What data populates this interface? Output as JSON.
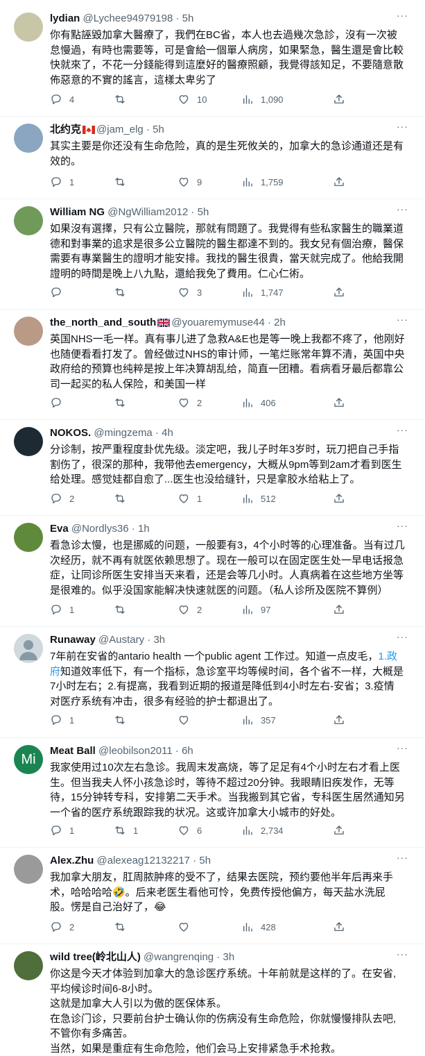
{
  "tweets": [
    {
      "name": "lydian",
      "handle": "@Lychee94979198",
      "time": "5h",
      "avatar_color": "#c9c6a8",
      "avatar_text": "",
      "flag": "",
      "lines": [
        "你有點誣毀加拿大醫療了，我們在BC省，本人也去過幾次急診，沒有一次被",
        "怠慢過，有時也需要等，可是會給一個單人病房，如果緊急，醫生還是會比較",
        "快就來了，不花一分錢能得到這麼好的醫療照顧，我覺得該知足，不要隨意散",
        "佈惡意的不實的謠言，這樣太卑劣了"
      ],
      "replies": "4",
      "retweets": "",
      "likes": "10",
      "views": "1,090"
    },
    {
      "name": "北约克",
      "handle": "@jam_elg",
      "time": "5h",
      "avatar_color": "#8aa6c0",
      "avatar_text": "",
      "flag": "ca",
      "lines": [
        "其实主要是你还没有生命危险，真的是生死攸关的，加拿大的急诊通道还是有",
        "效的。"
      ],
      "replies": "1",
      "retweets": "",
      "likes": "9",
      "views": "1,759"
    },
    {
      "name": "William NG",
      "handle": "@NgWilliam2012",
      "time": "5h",
      "avatar_color": "#6f9a5a",
      "avatar_text": "",
      "flag": "",
      "lines": [
        "如果沒有選擇，只有公立醫院，那就有問題了。我覺得有些私家醫生的職業道",
        "德和對事業的追求是很多公立醫院的醫生都達不到的。我女兒有個治療，醫保",
        "需要有專業醫生的證明才能安排。我找的醫生很貴，當天就完成了。他給我開",
        "證明的時間是晚上八九點，還給我免了費用。仁心仁術。"
      ],
      "replies": "",
      "retweets": "",
      "likes": "3",
      "views": "1,747"
    },
    {
      "name": "the_north_and_south",
      "handle": "@youaremymuse44",
      "time": "2h",
      "avatar_color": "#b99a86",
      "avatar_text": "",
      "flag": "gb",
      "lines": [
        "英国NHS一毛一样。真有事儿进了急救A&E也是等一晚上我都不疼了，他刚好",
        "也随便看看打发了。曾经做过NHS的审计师，一笔烂账常年算不清，英国中央",
        "政府给的预算也纯粹是按上年决算胡乱给，简直一团糟。看病看牙最后都靠公",
        "司一起买的私人保险，和美国一样"
      ],
      "replies": "",
      "retweets": "",
      "likes": "2",
      "views": "406"
    },
    {
      "name": "NOKOS.",
      "handle": "@mingzema",
      "time": "4h",
      "avatar_color": "#1d2a33",
      "avatar_text": "",
      "flag": "",
      "lines": [
        "分诊制，按严重程度卦优先级。淡定吧，我儿子时年3岁时，玩刀把自己手指",
        "割伤了，很深的那种，我带他去emergency，大概从9pm等到2am才看到医生",
        "给处理。感觉娃都自愈了...医生也没给缝针，只是拿胶水给粘上了。"
      ],
      "replies": "2",
      "retweets": "",
      "likes": "1",
      "views": "512"
    },
    {
      "name": "Eva",
      "handle": "@Nordlys36",
      "time": "1h",
      "avatar_color": "#5f8a3c",
      "avatar_text": "",
      "flag": "",
      "lines": [
        "看急诊太慢，也是挪威的问题，一般要有3，4个小时等的心理准备。当有过几",
        "次经历，就不再有就医依赖思想了。现在一般可以在固定医生处一早电话报急",
        "症，让同诊所医生安排当天来看，还是会等几小时。人真病着在这些地方坐等",
        "是很难的。似乎没国家能解决快速就医的问题。（私人诊所及医院不算例）"
      ],
      "replies": "1",
      "retweets": "",
      "likes": "2",
      "views": "97"
    },
    {
      "name": "Runaway",
      "handle": "@Austary",
      "time": "3h",
      "avatar_color": "#cfd9de",
      "avatar_text": "",
      "flag": "",
      "line1_pre": "7年前在安省的antario health 一个public agent 工作过。知道一点皮毛，",
      "line1_link": "1.政",
      "line2_link": "府",
      "line2_post": "知道效率低下，有一个指标，急诊室平均等候时间，各个省不一样，大概是",
      "lines": [
        "7小时左右；2.有提高，我看到近期的报道是降低到4小时左右-安省；3.疫情",
        "对医疗系统有冲击，很多有经验的护士都退出了。"
      ],
      "replies": "1",
      "retweets": "",
      "likes": "",
      "views": "357"
    },
    {
      "name": "Meat Ball",
      "handle": "@leobilson2011",
      "time": "6h",
      "avatar_color": "#1a8551",
      "avatar_text": "Mi",
      "flag": "",
      "lines": [
        "我家使用过10次左右急诊。我周末发高烧，等了足足有4个小时左右才看上医",
        "生。但当我夫人怀小孩急诊时，等待不超过20分钟。我眼睛旧疾发作，无等",
        "待，15分钟转专科，安排第二天手术。当我搬到其它省，专科医生居然通知另",
        "一个省的医疗系统跟踪我的状况。这或许加拿大小城市的好处。"
      ],
      "replies": "1",
      "retweets": "1",
      "likes": "6",
      "views": "2,734"
    },
    {
      "name": "Alex.Zhu",
      "handle": "@alexeag12132217",
      "time": "5h",
      "avatar_color": "#9a9a9a",
      "avatar_text": "",
      "flag": "",
      "lines": [
        "我加拿大朋友，肛周脓肿疼的受不了，结果去医院，预约要他半年后再来手",
        "术，哈哈哈哈🤣。后来老医生看他可怜，免费传授他偏方，每天盐水洗屁",
        "股。愣是自己治好了，😂"
      ],
      "replies": "2",
      "retweets": "",
      "likes": "",
      "views": "428"
    },
    {
      "name": "wild tree(岭北山人)",
      "handle": "@wangrenqing",
      "time": "3h",
      "avatar_color": "#4f6e3a",
      "avatar_text": "",
      "flag": "",
      "lines": [
        "你这是今天才体验到加拿大的急诊医疗系统。十年前就是这样的了。在安省,",
        "平均候诊时间6-8小时。",
        "这就是加拿大人引以为傲的医保体系。",
        "在急诊门诊，只要前台护士确认你的伤病没有生命危险，你就慢慢排队去吧,",
        "不管你有多痛苦。",
        "当然，如果是重症有生命危险，他们会马上安排紧急手术抢救。"
      ],
      "replies": "",
      "retweets": "",
      "likes": "",
      "views": ""
    }
  ]
}
